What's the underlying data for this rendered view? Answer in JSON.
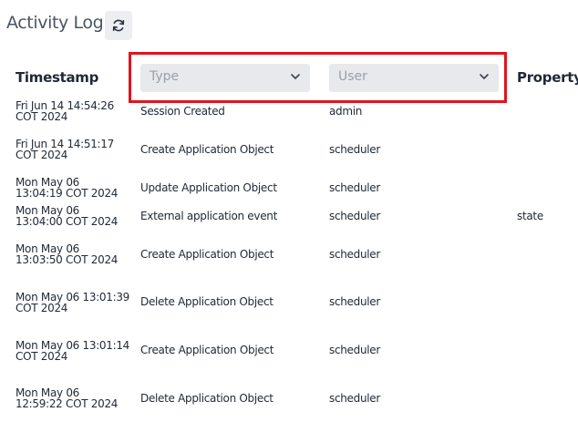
{
  "title": "Activity Log",
  "columns": {
    "timestamp": "Timestamp",
    "property": "Property"
  },
  "filters": {
    "type_placeholder": "Type",
    "user_placeholder": "User"
  },
  "rows": [
    {
      "ts1": "Fri Jun 14 14:54:26",
      "ts2": "COT 2024",
      "type": "Session Created",
      "user": "admin",
      "property": ""
    },
    {
      "ts1": "Fri Jun 14 14:51:17",
      "ts2": "COT 2024",
      "type": "Create Application Object",
      "user": "scheduler",
      "property": ""
    },
    {
      "ts1": "Mon May 06",
      "ts2": "13:04:19 COT 2024",
      "type": "Update Application Object",
      "user": "scheduler",
      "property": ""
    },
    {
      "ts1": "Mon May 06",
      "ts2": "13:04:00 COT 2024",
      "type": "External application event",
      "user": "scheduler",
      "property": "state"
    },
    {
      "ts1": "Mon May 06",
      "ts2": "13:03:50 COT 2024",
      "type": "Create Application Object",
      "user": "scheduler",
      "property": ""
    },
    {
      "ts1": "Mon May 06 13:01:39",
      "ts2": "COT 2024",
      "type": "Delete Application Object",
      "user": "scheduler",
      "property": ""
    },
    {
      "ts1": "Mon May 06 13:01:14",
      "ts2": "COT 2024",
      "type": "Create Application Object",
      "user": "scheduler",
      "property": ""
    },
    {
      "ts1": "Mon May 06",
      "ts2": "12:59:22 COT 2024",
      "type": "Delete Application Object",
      "user": "scheduler",
      "property": ""
    }
  ],
  "icons": {
    "refresh": "refresh-icon",
    "dropdown": "chevron-down-icon"
  },
  "colors": {
    "highlight": "#e0141e",
    "filter_bg": "#e7e9ed"
  }
}
